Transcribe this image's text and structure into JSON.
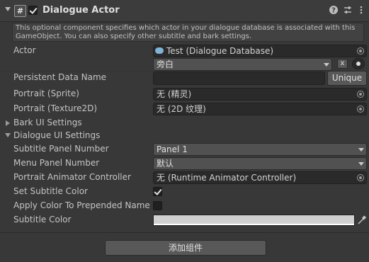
{
  "component": {
    "title": "Dialogue Actor",
    "description": "This optional component specifies which actor in your dialogue database is associated with this GameObject. You can also specify other subtitle and bark settings.",
    "enabled": true
  },
  "fields": {
    "actor_label": "Actor",
    "actor_value": "Test (Dialogue Database)",
    "actor_name_value": "旁白",
    "actor_clear_label": "x",
    "persistent_label": "Persistent Data Name",
    "persistent_value": "",
    "unique_button": "Unique",
    "portrait_sprite_label": "Portrait (Sprite)",
    "portrait_sprite_value": "无 (精灵)",
    "portrait_tex_label": "Portrait (Texture2D)",
    "portrait_tex_value": "无 (2D 纹理)"
  },
  "sections": {
    "bark_ui": "Bark UI Settings",
    "dialogue_ui": "Dialogue UI Settings"
  },
  "dialogue_ui": {
    "subtitle_panel_label": "Subtitle Panel Number",
    "subtitle_panel_value": "Panel 1",
    "menu_panel_label": "Menu Panel Number",
    "menu_panel_value": "默认",
    "portrait_animator_label": "Portrait Animator Controller",
    "portrait_animator_value": "无 (Runtime Animator Controller)",
    "set_subtitle_color_label": "Set Subtitle Color",
    "set_subtitle_color_checked": true,
    "apply_color_label": "Apply Color To Prepended Name",
    "apply_color_checked": false,
    "subtitle_color_label": "Subtitle Color",
    "subtitle_color_value": "#d0d0d0"
  },
  "footer": {
    "add_component": "添加组件"
  }
}
